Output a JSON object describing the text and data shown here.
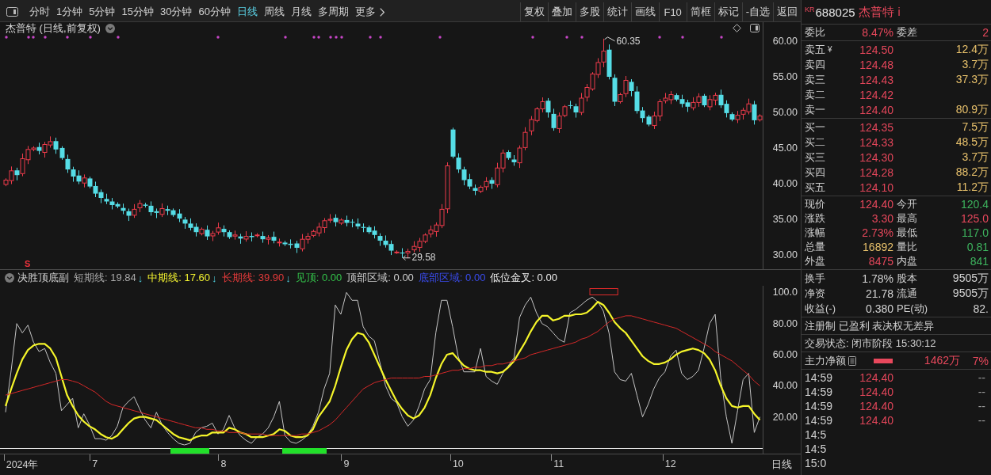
{
  "toolbar": {
    "periods": [
      {
        "label": "分时",
        "kind": "period",
        "selected": false
      },
      {
        "label": "1分钟",
        "kind": "period",
        "selected": false
      },
      {
        "label": "5分钟",
        "kind": "period",
        "selected": false
      },
      {
        "label": "15分钟",
        "kind": "period",
        "selected": false
      },
      {
        "label": "30分钟",
        "kind": "period",
        "selected": false
      },
      {
        "label": "60分钟",
        "kind": "period",
        "selected": false
      },
      {
        "label": "日线",
        "kind": "period",
        "selected": true
      },
      {
        "label": "周线",
        "kind": "period",
        "selected": false
      },
      {
        "label": "月线",
        "kind": "period",
        "selected": false
      },
      {
        "label": "多周期",
        "kind": "period",
        "selected": false
      },
      {
        "label": "更多",
        "kind": "menu",
        "selected": false
      }
    ],
    "actions": [
      "复权",
      "叠加",
      "多股",
      "统计",
      "画线",
      "F10",
      "简框",
      "标记",
      "-自选",
      "返回"
    ]
  },
  "price_chart": {
    "title": "杰普特 (日线,前复权)",
    "axis_labels": [
      "60.00",
      "55.00",
      "50.00",
      "45.00",
      "40.00",
      "35.00",
      "30.00"
    ],
    "high_label": "60.35",
    "low_label": "29.58",
    "signal_mark": "S"
  },
  "indicator": {
    "title": "决胜顶底副",
    "legend": [
      {
        "text": "短期线: 19.84",
        "color": "#a8a8a8",
        "arrow": "↓"
      },
      {
        "text": "中期线: 17.60",
        "color": "#f2f230",
        "arrow": "↓"
      },
      {
        "text": "长期线: 39.90",
        "color": "#e23a3a",
        "arrow": "↓"
      },
      {
        "text": "见顶: 0.00",
        "color": "#33c24a"
      },
      {
        "text": "顶部区域: 0.00",
        "color": "#cfcfcf"
      },
      {
        "text": "底部区域: 0.00",
        "color": "#3a4cf0"
      },
      {
        "text": "低位金叉: 0.00",
        "color": "#ececec"
      }
    ],
    "chart_data": {
      "type": "line",
      "categories": [
        null,
        null,
        null,
        "2024年",
        null,
        null,
        null,
        null,
        null,
        null,
        null,
        null,
        null,
        null,
        null,
        null,
        "7",
        null,
        null,
        null,
        null,
        null,
        null,
        null,
        null,
        null,
        null,
        null,
        null,
        null,
        null,
        null,
        null,
        null,
        null,
        null,
        null,
        null,
        null,
        "8",
        null,
        null,
        null,
        null,
        null,
        null,
        null,
        null,
        null,
        null,
        null,
        null,
        null,
        null,
        null,
        null,
        null,
        null,
        null,
        null,
        null,
        "9",
        null,
        null,
        null,
        null,
        null,
        null,
        null,
        null,
        null,
        null,
        null,
        null,
        null,
        null,
        null,
        null,
        null,
        null,
        null,
        "10",
        null,
        null,
        null,
        null,
        null,
        null,
        null,
        null,
        null,
        null,
        null,
        null,
        null,
        null,
        null,
        null,
        null,
        "11",
        null,
        null,
        null,
        null,
        null,
        null,
        null,
        null,
        null,
        null,
        null,
        null,
        null,
        null,
        null,
        null,
        null,
        null,
        null,
        "12",
        null,
        null,
        null,
        null,
        null,
        null,
        null,
        null,
        null,
        null,
        null,
        null,
        null,
        null,
        null,
        null
      ],
      "ylim": [
        -3.6,
        104.3
      ],
      "yticks": [
        {
          "value": 100,
          "label": "100.0"
        },
        {
          "value": 80,
          "label": "80.00"
        },
        {
          "value": 60,
          "label": "60.00"
        },
        {
          "value": 40,
          "label": "40.00"
        },
        {
          "value": 20,
          "label": "20.00"
        }
      ],
      "series": [
        {
          "color": "#c4c4c4",
          "values": [
            23,
            50,
            80,
            74,
            79,
            68,
            62,
            64,
            55,
            48,
            24,
            28,
            32,
            13,
            22,
            15,
            6,
            6,
            5,
            8,
            14,
            26,
            30,
            33,
            25,
            18,
            13,
            23,
            15,
            10,
            6,
            3,
            2,
            3,
            10,
            13,
            14,
            16,
            9,
            12,
            21,
            13,
            8,
            5,
            3,
            7,
            9,
            13,
            20,
            30,
            8,
            4,
            3,
            5,
            8,
            14,
            23,
            38,
            48,
            92,
            86,
            100,
            95,
            95,
            78,
            72,
            69,
            55,
            40,
            32,
            29,
            20,
            14,
            18,
            27,
            38,
            44,
            74,
            95,
            95,
            78,
            59,
            49,
            49,
            49,
            64,
            46,
            43,
            41,
            48,
            53,
            58,
            84,
            92,
            97,
            87,
            80,
            78,
            74,
            70,
            68,
            87,
            89,
            92,
            95,
            97,
            94,
            88,
            74,
            49,
            44,
            43,
            48,
            34,
            20,
            28,
            38,
            45,
            49,
            59,
            63,
            48,
            44,
            46,
            50,
            64,
            80,
            86,
            45,
            20,
            3,
            24,
            44,
            48,
            10,
            20
          ]
        },
        {
          "color": "#f5f52a",
          "values": [
            27,
            38,
            48,
            57,
            63,
            66,
            67,
            67,
            64,
            58,
            46,
            34,
            27,
            21,
            17,
            14,
            12,
            9,
            7,
            6,
            8,
            12,
            16,
            19,
            20,
            20,
            19,
            18,
            15,
            12,
            9,
            7,
            6,
            5,
            7,
            8,
            8,
            10,
            10,
            10,
            13,
            12,
            10,
            9,
            7,
            7,
            7,
            8,
            9,
            12,
            11,
            8,
            7,
            7,
            8,
            12,
            20,
            25,
            30,
            40,
            52,
            63,
            70,
            74,
            73,
            68,
            60,
            52,
            44,
            37,
            30,
            25,
            21,
            19,
            21,
            26,
            34,
            45,
            54,
            60,
            61,
            57,
            53,
            51,
            50,
            50,
            49,
            49,
            48,
            49,
            52,
            56,
            62,
            68,
            75,
            81,
            85,
            85,
            82,
            83,
            85,
            85,
            86,
            86,
            87,
            90,
            94,
            92,
            87,
            81,
            77,
            74,
            69,
            64,
            59,
            56,
            54,
            54,
            55,
            57,
            60,
            62,
            63,
            64,
            63,
            61,
            57,
            50,
            40,
            32,
            27,
            26,
            27,
            27,
            22,
            18
          ]
        },
        {
          "color": "#d62828",
          "values": [
            34,
            35,
            36,
            37,
            38,
            39,
            40,
            41,
            42,
            43,
            44,
            44,
            43,
            42,
            40,
            38,
            36,
            33,
            30,
            28,
            27,
            26,
            25,
            24,
            23,
            22,
            21,
            20,
            19,
            18,
            17,
            16,
            15,
            14,
            13,
            13,
            12,
            12,
            11,
            11,
            10,
            10,
            10,
            9,
            9,
            9,
            9,
            8,
            8,
            8,
            8,
            8,
            8,
            9,
            9,
            10,
            11,
            13,
            15,
            18,
            22,
            26,
            30,
            34,
            38,
            40,
            42,
            43,
            44,
            45,
            45,
            45,
            45,
            45,
            45,
            46,
            46,
            47,
            48,
            49,
            50,
            50,
            51,
            51,
            52,
            52,
            53,
            53,
            54,
            54,
            55,
            56,
            57,
            58,
            60,
            61,
            62,
            63,
            64,
            65,
            66,
            67,
            68,
            70,
            71,
            73,
            75,
            78,
            81,
            83,
            84,
            85,
            85,
            84,
            83,
            82,
            81,
            80,
            79,
            78,
            77,
            75,
            73,
            71,
            69,
            67,
            65,
            62,
            60,
            58,
            56,
            53,
            50,
            47,
            43,
            40
          ]
        }
      ]
    }
  },
  "date_axis": {
    "period": "日线"
  },
  "quote": {
    "market": "KR",
    "code": "688025",
    "name": "杰普特",
    "info": "i",
    "ratio": [
      {
        "label": "委比",
        "value": "8.47%",
        "color": "#e8485c"
      },
      {
        "label": "委差",
        "value": "2",
        "color": "#e8485c"
      }
    ],
    "asks": [
      {
        "label": "卖五",
        "tag": "¥",
        "price": "124.50",
        "volume": "12.4万"
      },
      {
        "label": "卖四",
        "price": "124.48",
        "volume": "3.7万"
      },
      {
        "label": "卖三",
        "price": "124.43",
        "volume": "37.3万"
      },
      {
        "label": "卖二",
        "price": "124.42"
      },
      {
        "label": "卖一",
        "price": "124.40",
        "volume": "80.9万"
      }
    ],
    "bids": [
      {
        "label": "买一",
        "price": "124.35",
        "volume": "7.5万"
      },
      {
        "label": "买二",
        "price": "124.33",
        "volume": "48.5万"
      },
      {
        "label": "买三",
        "price": "124.30",
        "volume": "3.7万"
      },
      {
        "label": "买四",
        "price": "124.28",
        "volume": "88.2万"
      },
      {
        "label": "买五",
        "price": "124.10",
        "volume": "11.2万"
      }
    ],
    "stats": [
      [
        {
          "label": "现价",
          "value": "124.40",
          "color": "#e8485c"
        },
        {
          "label": "今开",
          "value": "120.4",
          "color": "#3db45e"
        }
      ],
      [
        {
          "label": "涨跌",
          "value": "3.30",
          "color": "#e8485c"
        },
        {
          "label": "最高",
          "value": "125.0",
          "color": "#e8485c"
        }
      ],
      [
        {
          "label": "涨幅",
          "value": "2.73%",
          "color": "#e8485c"
        },
        {
          "label": "最低",
          "value": "117.0",
          "color": "#3db45e"
        }
      ],
      [
        {
          "label": "总量",
          "value": "16892",
          "color": "#e7c06b"
        },
        {
          "label": "量比",
          "value": "0.81",
          "color": "#3db45e"
        }
      ],
      [
        {
          "label": "外盘",
          "value": "8475",
          "color": "#e8485c"
        },
        {
          "label": "内盘",
          "value": "841",
          "color": "#3db45e"
        }
      ]
    ],
    "fundamentals": [
      [
        {
          "label": "换手",
          "value": "1.78%",
          "color": "#d4d4d4"
        },
        {
          "label": "股本",
          "value": "9505万",
          "color": "#d4d4d4"
        }
      ],
      [
        {
          "label": "净资",
          "value": "21.78",
          "color": "#d4d4d4"
        },
        {
          "label": "流通",
          "value": "9505万",
          "color": "#d4d4d4"
        }
      ],
      [
        {
          "label": "收益(-)",
          "value": "0.380",
          "color": "#d4d4d4"
        },
        {
          "label": "PE(动)",
          "value": "82.",
          "color": "#d4d4d4"
        }
      ]
    ],
    "notes": [
      "注册制 已盈利 表决权无差异",
      "交易状态: 闭市阶段 15:30:12"
    ],
    "main_flow": {
      "label": "主力净额",
      "amount": "1462万",
      "share": "7%"
    },
    "ticks": [
      {
        "time": "14:59",
        "price": "124.40",
        "volume": "--"
      },
      {
        "time": "14:59",
        "price": "124.40",
        "volume": "--"
      },
      {
        "time": "14:59",
        "price": "124.40",
        "volume": "--"
      },
      {
        "time": "14:59",
        "price": "124.40",
        "volume": "--"
      },
      {
        "time": "14:5"
      },
      {
        "time": "14:5"
      },
      {
        "time": "15:0"
      }
    ]
  }
}
